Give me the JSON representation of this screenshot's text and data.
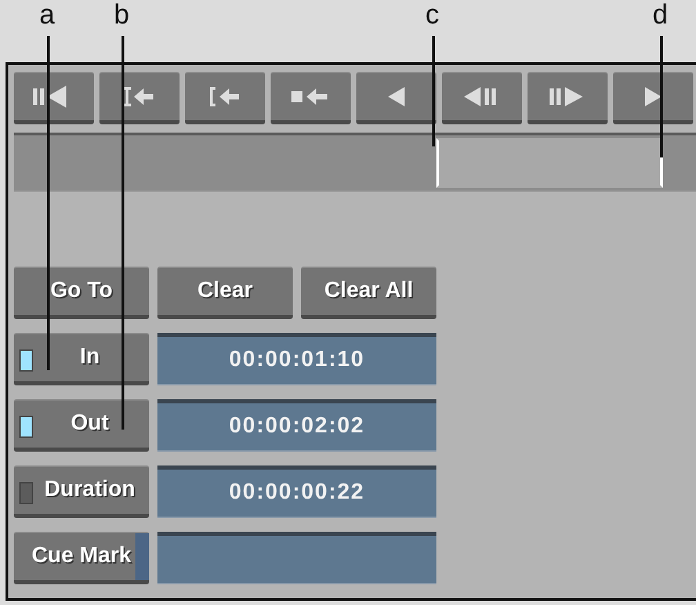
{
  "callouts": [
    {
      "label": "a"
    },
    {
      "label": "b"
    },
    {
      "label": "c"
    },
    {
      "label": "d"
    }
  ],
  "timeline": {
    "marked_range": true
  },
  "action_buttons": [
    {
      "label": "Go To"
    },
    {
      "label": "Clear"
    },
    {
      "label": "Clear All"
    }
  ],
  "rows": [
    {
      "label": "In",
      "kind": "led",
      "lit": true,
      "value": "00:00:01:10"
    },
    {
      "label": "Out",
      "kind": "led",
      "lit": true,
      "value": "00:00:02:02"
    },
    {
      "label": "Duration",
      "kind": "led",
      "lit": false,
      "value": "00:00:00:22"
    },
    {
      "label": "Cue Mark",
      "kind": "strip"
    }
  ]
}
